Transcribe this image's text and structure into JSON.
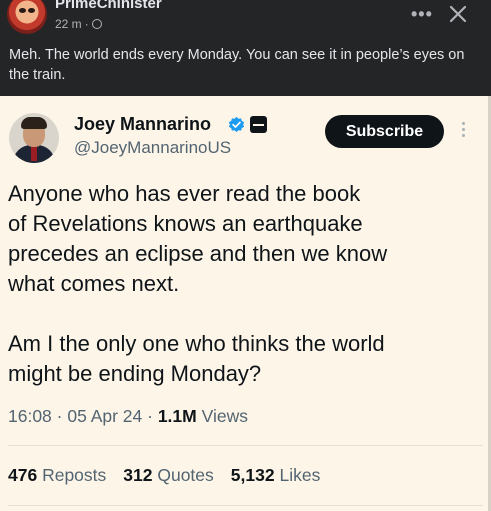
{
  "facebook_post": {
    "author_name": "PrimeChinister",
    "time": "22 m",
    "more_label": "•••",
    "text": "Meh. The world ends every Monday. You can see it in people’s eyes on the train."
  },
  "tweet": {
    "author_name": "Joey Mannarino",
    "handle": "@JoeyMannarinoUS",
    "subscribe_label": "Subscribe",
    "body_paragraphs": [
      "Anyone who has ever read the book\nof Revelations knows an earthquake\nprecedes an eclipse and then we know\nwhat comes next.",
      "Am I the only one who thinks the world\nmight be ending Monday?"
    ],
    "timestamp": "16:08 · 05 Apr 24 · ",
    "views_count": "1.1M",
    "views_label": " Views",
    "stats": {
      "reposts_count": "476",
      "reposts_label": "Reposts",
      "quotes_count": "312",
      "quotes_label": "Quotes",
      "likes_count": "5,132",
      "likes_label": "Likes"
    }
  },
  "colors": {
    "fb_background": "#242526",
    "tweet_background": "#fdf6e8",
    "verified_blue": "#1d9bf0"
  },
  "icons": [
    "globe-icon",
    "more-icon",
    "close-icon",
    "verified-badge-icon",
    "affiliate-badge-icon",
    "kebab-menu-icon"
  ]
}
